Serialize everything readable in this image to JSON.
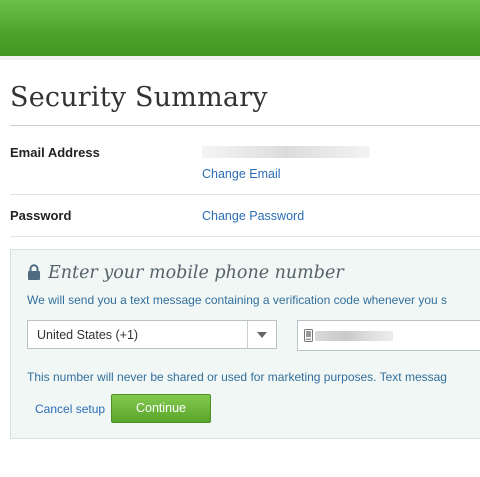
{
  "page": {
    "title": "Security Summary"
  },
  "rows": {
    "email": {
      "label": "Email Address",
      "link": "Change Email"
    },
    "password": {
      "label": "Password",
      "link": "Change Password"
    }
  },
  "phone_panel": {
    "heading": "Enter your mobile phone number",
    "intro": "We will send you a text message containing a verification code whenever you s",
    "country_select": {
      "selected": "United States (+1)"
    },
    "disclaimer": "This number will never be shared or used for marketing purposes. Text messag",
    "cancel_label": "Cancel setup",
    "continue_label": "Continue"
  },
  "colors": {
    "brand_green": "#5aa52a",
    "link_blue": "#2a6db5",
    "panel_bg": "#f1f7f5"
  },
  "icons": {
    "lock": "lock-icon",
    "phone": "phone-icon",
    "dropdown": "chevron-down-icon"
  }
}
